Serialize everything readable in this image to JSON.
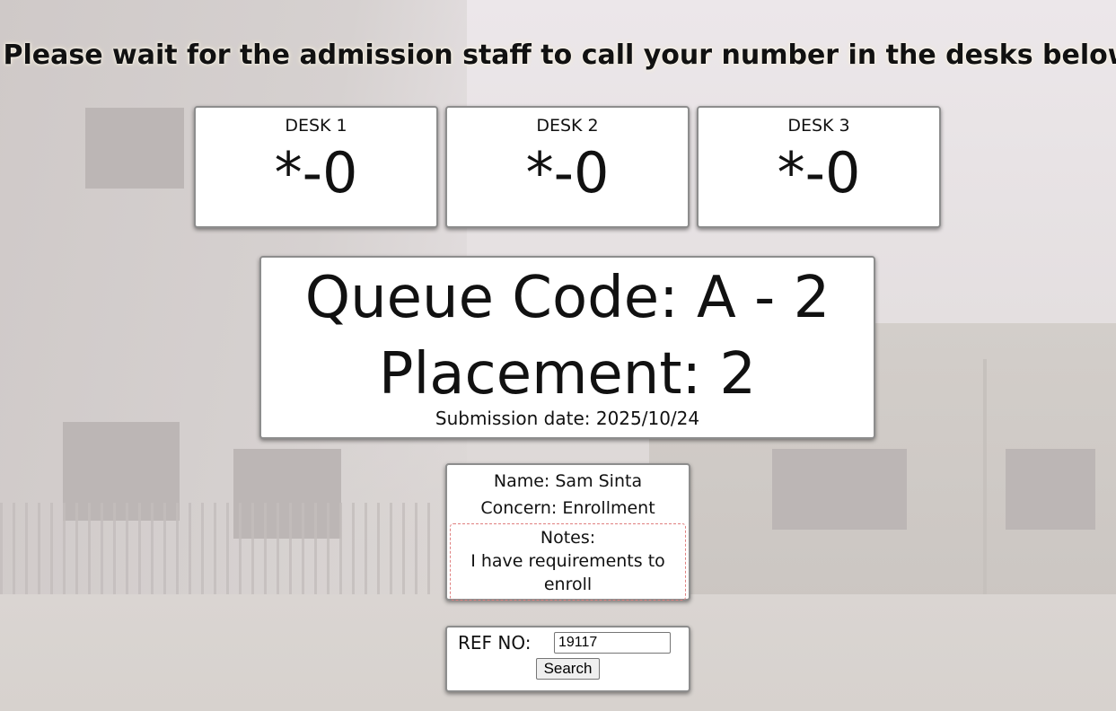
{
  "headline": "Please wait for the admission staff to call your number in the desks below",
  "desks": [
    {
      "label": "DESK 1",
      "number": "*-0"
    },
    {
      "label": "DESK 2",
      "number": "*-0"
    },
    {
      "label": "DESK 3",
      "number": "*-0"
    }
  ],
  "queue": {
    "code_text": "Queue Code: A - 2",
    "placement_text": "Placement: 2",
    "submission_text": "Submission date: 2025/10/24"
  },
  "info": {
    "name_text": "Name: Sam Sinta",
    "concern_text": "Concern: Enrollment",
    "notes_label": "Notes:",
    "notes_text": "I have requirements to enroll"
  },
  "reference": {
    "label": "REF NO:",
    "value": "19117",
    "search_label": "Search"
  }
}
